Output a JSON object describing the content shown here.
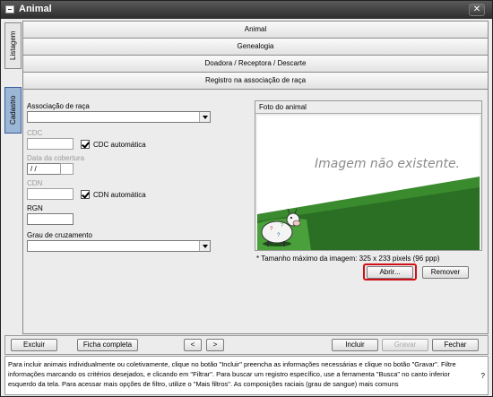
{
  "window": {
    "title": "Animal",
    "close_glyph": "✕"
  },
  "side_tabs": {
    "listagem": "Listagem",
    "cadastro": "Cadastro"
  },
  "tabs": [
    {
      "label": "Animal"
    },
    {
      "label": "Genealogia"
    },
    {
      "label": "Doadora / Receptora / Descarte"
    },
    {
      "label": "Registro na associação de raça"
    }
  ],
  "form": {
    "associacao_label": "Associação de raça",
    "associacao_value": "",
    "cdc_label": "CDC",
    "cdc_value": "",
    "cdc_auto_label": "CDC automática",
    "cdc_auto_checked": true,
    "cobertura_label": "Data da cobertura",
    "cobertura_value": " / /",
    "cdn_label": "CDN",
    "cdn_value": "",
    "cdn_auto_label": "CDN automática",
    "cdn_auto_checked": true,
    "rgn_label": "RGN",
    "rgn_value": "",
    "grau_label": "Grau de cruzamento",
    "grau_value": ""
  },
  "photo": {
    "header": "Foto do animal",
    "no_image_text": "Imagem não existente.",
    "size_note": "* Tamanho máximo da  imagem: 325 x 233 pixels (96 ppp)",
    "open_button": "Abrir...",
    "remove_button": "Remover"
  },
  "toolbar": {
    "excluir": "Excluir",
    "ficha": "Ficha completa",
    "prev": "<",
    "next": ">",
    "incluir": "Incluir",
    "gravar": "Gravar",
    "fechar": "Fechar"
  },
  "help": {
    "text": "Para incluir animais individualmente ou coletivamente, clique no botão \"Incluir\" preencha as informações necessárias e clique no botão \"Gravar\". Filtre informações marcando os critérios desejados, e clicando em \"Filtrar\". Para buscar um registro específico, use a ferramenta \"Busca\" no canto inferior esquerdo da tela. Para acessar mais opções de filtro, utilize o \"Mais filtros\". As composições raciais (grau de sangue) mais comuns",
    "question_mark": "?"
  },
  "colors": {
    "highlight": "#d01018",
    "active_tab": "#9cb6d6",
    "grass": "#2f7a2a"
  }
}
